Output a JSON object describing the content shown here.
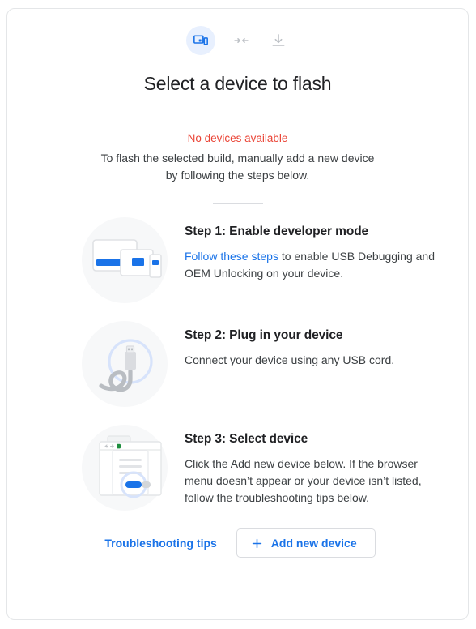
{
  "card": {
    "header_icons": [
      {
        "name": "devices-icon",
        "label": "devices",
        "active": true
      },
      {
        "name": "compress-arrows-icon",
        "label": "compress",
        "active": false
      },
      {
        "name": "download-icon",
        "label": "download",
        "active": false
      }
    ],
    "title": "Select a device to flash",
    "status": {
      "error": "No devices available",
      "description": "To flash the selected build, manually add a new device by following the steps below."
    },
    "steps": [
      {
        "art": "devices-illustration",
        "title": "Step 1: Enable developer mode",
        "link_text": "Follow these steps",
        "text_after_link": " to enable USB Debugging and OEM Unlocking on your device."
      },
      {
        "art": "usb-cable-illustration",
        "title": "Step 2: Plug in your device",
        "text": "Connect your device using any USB cord."
      },
      {
        "art": "browser-dialog-illustration",
        "title": "Step 3: Select device",
        "text": "Click the Add new device below. If the browser menu doesn’t appear or your device isn’t listed, follow the troubleshooting tips below."
      }
    ],
    "footer": {
      "troubleshooting_label": "Troubleshooting tips",
      "add_device_label": "Add new device",
      "add_icon": "plus-icon"
    },
    "colors": {
      "accent_blue": "#1a73e8",
      "error_red": "#ea4335",
      "icon_chip_bg": "#e8f0fe",
      "art_circle_bg": "#f7f8f9",
      "border": "#dadce0",
      "text_primary": "#202124",
      "text_secondary": "#3c4043"
    }
  }
}
